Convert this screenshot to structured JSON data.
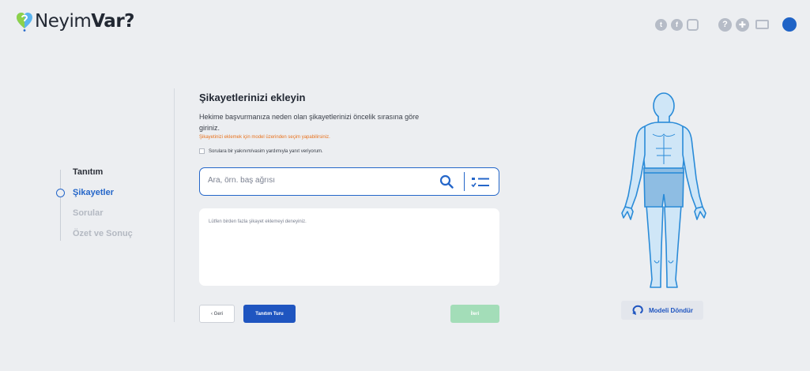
{
  "brand": {
    "name_light": "Neyim",
    "name_bold": "Var?"
  },
  "top_icons": [
    "twitter-icon",
    "facebook-icon",
    "instagram-icon",
    "help-icon",
    "lifebuoy-icon",
    "mail-icon",
    "user-icon"
  ],
  "steps": [
    {
      "label": "Tanıtım",
      "state": "done"
    },
    {
      "label": "Şikayetler",
      "state": "active"
    },
    {
      "label": "Sorular",
      "state": "todo"
    },
    {
      "label": "Özet ve Sonuç",
      "state": "todo"
    }
  ],
  "main": {
    "title": "Şikayetlerinizi ekleyin",
    "description": "Hekime başvurmanıza neden olan şikayetlerinizi öncelik sırasına göre giriniz.",
    "warning": "Şikayetinizi eklemek için model üzerinden seçim yapabilirsiniz.",
    "checkbox_label": "Sorulara bir yakınım/vasim yardımıyla yanıt veriyorum.",
    "search_placeholder": "Ara, örn. baş ağrısı",
    "textbox_placeholder": "Lütfen birden fazla şikayet eklemeyi deneyiniz."
  },
  "buttons": {
    "back": "‹  Geri",
    "tour": "Tanıtım Turu",
    "next": "İleri"
  },
  "model": {
    "rotate_label": "Modeli Döndür"
  },
  "colors": {
    "accent": "#2466c9",
    "brand_button": "#1f55c0",
    "warning": "#e8721d",
    "next_disabled": "#a3ddb8",
    "body_fill": "#cfe6f7",
    "body_stroke": "#2a8bd8"
  }
}
